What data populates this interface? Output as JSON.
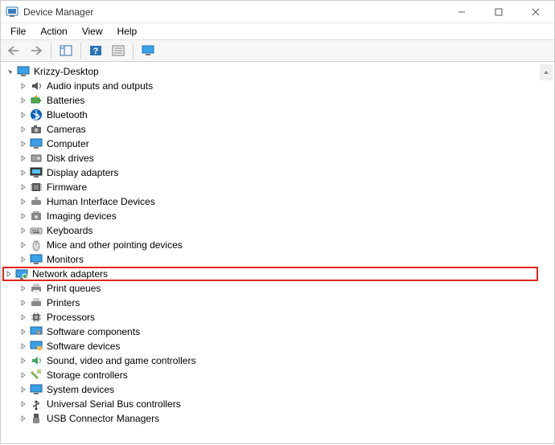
{
  "titlebar": {
    "icon": "device-manager-icon",
    "title": "Device Manager",
    "controls": {
      "min": "minimize",
      "max": "maximize",
      "close": "close"
    }
  },
  "menubar": {
    "items": [
      "File",
      "Action",
      "View",
      "Help"
    ]
  },
  "toolbar": {
    "buttons": [
      {
        "name": "nav-back-icon"
      },
      {
        "name": "nav-forward-icon"
      },
      {
        "name": "show-hide-icon"
      },
      {
        "name": "help-icon"
      },
      {
        "name": "properties-icon"
      },
      {
        "name": "monitor-icon"
      }
    ]
  },
  "tree": {
    "root": {
      "label": "Krizzy-Desktop",
      "expanded": true,
      "icon": "computer-icon"
    },
    "children": [
      {
        "label": "Audio inputs and outputs",
        "icon": "speaker-icon"
      },
      {
        "label": "Batteries",
        "icon": "battery-icon"
      },
      {
        "label": "Bluetooth",
        "icon": "bluetooth-icon"
      },
      {
        "label": "Cameras",
        "icon": "camera-icon"
      },
      {
        "label": "Computer",
        "icon": "monitor-icon"
      },
      {
        "label": "Disk drives",
        "icon": "disk-icon"
      },
      {
        "label": "Display adapters",
        "icon": "display-icon"
      },
      {
        "label": "Firmware",
        "icon": "firmware-icon"
      },
      {
        "label": "Human Interface Devices",
        "icon": "hid-icon"
      },
      {
        "label": "Imaging devices",
        "icon": "imaging-icon"
      },
      {
        "label": "Keyboards",
        "icon": "keyboard-icon"
      },
      {
        "label": "Mice and other pointing devices",
        "icon": "mouse-icon"
      },
      {
        "label": "Monitors",
        "icon": "monitor-icon"
      },
      {
        "label": "Network adapters",
        "icon": "network-icon",
        "highlighted": true
      },
      {
        "label": "Print queues",
        "icon": "print-queue-icon"
      },
      {
        "label": "Printers",
        "icon": "printer-icon"
      },
      {
        "label": "Processors",
        "icon": "cpu-icon"
      },
      {
        "label": "Software components",
        "icon": "software-component-icon"
      },
      {
        "label": "Software devices",
        "icon": "software-device-icon"
      },
      {
        "label": "Sound, video and game controllers",
        "icon": "sound-icon"
      },
      {
        "label": "Storage controllers",
        "icon": "storage-icon"
      },
      {
        "label": "System devices",
        "icon": "system-icon"
      },
      {
        "label": "Universal Serial Bus controllers",
        "icon": "usb-controller-icon"
      },
      {
        "label": "USB Connector Managers",
        "icon": "usb-connector-icon"
      }
    ]
  }
}
